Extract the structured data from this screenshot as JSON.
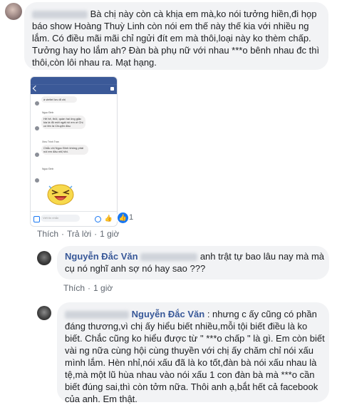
{
  "comment1": {
    "text": "Bà chị này còn cà khịa em mà,ko nói tưởng hiền,đi họp báo show Hoàng Thuỳ Linh còn nói em thế này thế kia với nhiều ng lắm. Có điều mãi mãi chỉ ngửi đít em mà thôi,loại này ko thèm chấp. Tưởng hay ho lắm ah? Đàn bà phụ nữ với nhau ***o bênh nhau đc thì thôi,còn lôi nhau ra. Mạt hạng.",
    "like_label": "Thích",
    "reply_label": "Trả lời",
    "time": "1 giờ",
    "reaction_count": "1"
  },
  "phone": {
    "messages": [
      "à viettel lưu đi chị",
      "Hê hê, thôi, quần hai ông giặc kia là đủ mệt ngất rồi em ơi Chị có tên là Chuyện đầu",
      "Chắc chị Ngọc Đinh không phải nói em đâu nhỉ,hihi."
    ],
    "names": [
      "Ngọc Đinh",
      "Xieu Trinh Tran",
      "Ngọc Đinh"
    ],
    "input_placeholder": "Viết tin nhắn"
  },
  "comment2": {
    "author": "Nguyễn Đắc Văn",
    "text": " anh trật tự bao lâu nay mà mà cụ nó nghĩ anh sợ nó hay sao ???",
    "like_label": "Thích",
    "time": "1 giờ"
  },
  "comment3": {
    "author": "Nguyễn Đắc Văn",
    "text": " : nhưng c ấy cũng có phần đáng thương,vì chị ấy hiểu biết nhiều,mỗi tội biết điều là ko biết. Chắc cũng ko hiểu được từ \" ***o chấp \" là gì. Em còn biết vài ng nữa cùng hội cùng thuyền với chị ấy chăm chỉ nói xấu mình lắm. Hèn nhỉ,nói xấu đã là ko tốt,đàn bà nói xấu nhau là tệ,mà một lũ hùa nhau vào nói xấu 1 con đàn bà mà ***o cần biết đúng sai,thì còn tởm nữa. Thôi anh ạ,bắt hết cả facebook của anh. Em thật."
  }
}
